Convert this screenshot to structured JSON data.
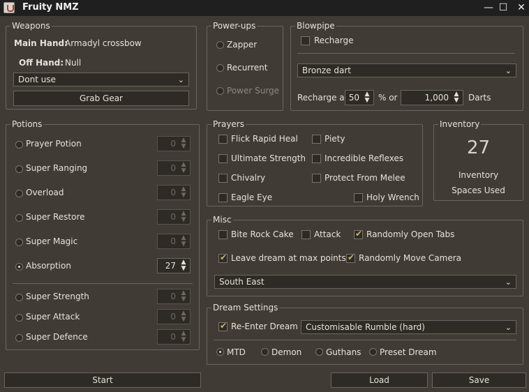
{
  "window": {
    "title": "Fruity NMZ",
    "minimize": "—",
    "maximize": "☐",
    "close": "✕"
  },
  "weapons": {
    "legend": "Weapons",
    "main_hand_label": "Main Hand:",
    "main_hand_value": "Armadyl crossbow",
    "off_hand_label": "Off Hand:",
    "off_hand_value": "Null",
    "combo_value": "Dont use",
    "grab_gear": "Grab Gear"
  },
  "powerups": {
    "legend": "Power-ups",
    "items": [
      "Zapper",
      "Recurrent",
      "Power Surge"
    ]
  },
  "blowpipe": {
    "legend": "Blowpipe",
    "recharge_label": "Recharge",
    "dart_value": "Bronze dart",
    "recharge_at_label": "Recharge at",
    "percent_value": "50",
    "percent_or_label": "% or",
    "darts_value": "1,000",
    "darts_label": "Darts"
  },
  "potions": {
    "legend": "Potions",
    "items": [
      {
        "label": "Prayer Potion",
        "value": "0"
      },
      {
        "label": "Super Ranging",
        "value": "0"
      },
      {
        "label": "Overload",
        "value": "0"
      },
      {
        "label": "Super Restore",
        "value": "0"
      },
      {
        "label": "Super Magic",
        "value": "0"
      },
      {
        "label": "Absorption",
        "value": "27"
      },
      {
        "label": "Super Strength",
        "value": "0"
      },
      {
        "label": "Super Attack",
        "value": "0"
      },
      {
        "label": "Super Defence",
        "value": "0"
      }
    ]
  },
  "prayers": {
    "legend": "Prayers",
    "items": [
      "Flick Rapid Heal",
      "Piety",
      "Ultimate Strength",
      "Incredible Reflexes",
      "Chivalry",
      "Protect From Melee",
      "Eagle Eye",
      "Holy Wrench"
    ]
  },
  "inventory": {
    "legend": "Inventory",
    "count": "27",
    "line1": "Inventory",
    "line2": "Spaces Used"
  },
  "misc": {
    "legend": "Misc",
    "bite_rock_cake": "Bite Rock Cake",
    "attack": "Attack",
    "randomly_open_tabs": "Randomly Open Tabs",
    "leave_dream": "Leave dream at max points",
    "randomly_move_camera": "Randomly Move Camera",
    "direction_value": "South East"
  },
  "dream": {
    "legend": "Dream Settings",
    "reenter_label": "Re-Enter Dream",
    "dream_value": "Customisable Rumble (hard)",
    "options": [
      "MTD",
      "Demon",
      "Guthans",
      "Preset Dream"
    ]
  },
  "footer": {
    "start": "Start",
    "load": "Load",
    "save": "Save"
  },
  "icons": {
    "combo_arrow": "⌄",
    "spin_up": "▲",
    "spin_down": "▼"
  },
  "colors": {
    "background": "#403c35",
    "titlebar": "#1f1f1f",
    "check_accent": "#d8b36a"
  }
}
